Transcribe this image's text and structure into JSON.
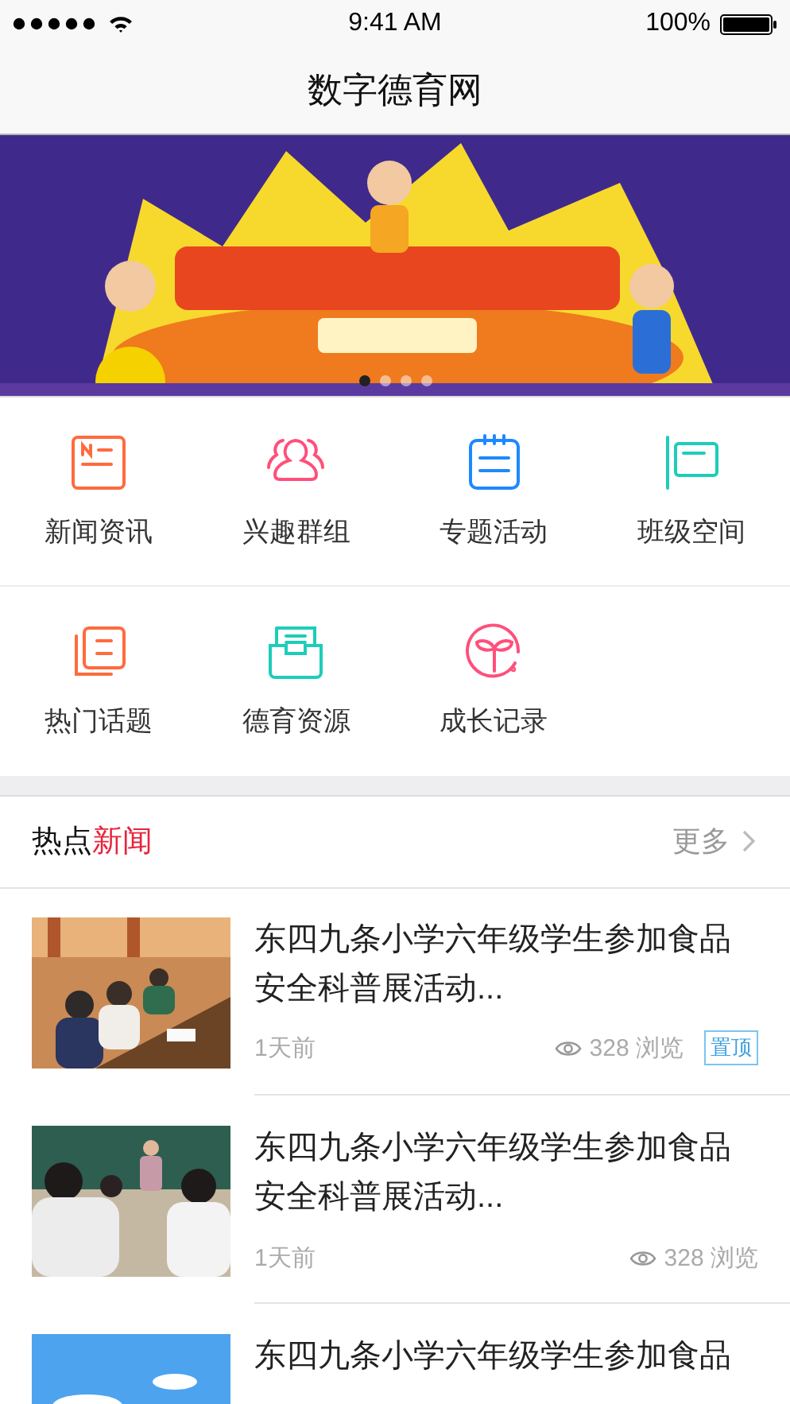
{
  "status_bar": {
    "time": "9:41 AM",
    "battery": "100%"
  },
  "nav": {
    "title": "数字德育网"
  },
  "banner": {
    "kind": "picture",
    "dots": [
      {
        "selected": true
      },
      {
        "selected": false
      },
      {
        "selected": false
      },
      {
        "selected": false
      }
    ]
  },
  "menu": [
    {
      "label": "新闻资讯",
      "color": "#ff6b3d"
    },
    {
      "label": "兴趣群组",
      "color": "#ff4f7b"
    },
    {
      "label": "专题活动",
      "color": "#1e88ff"
    },
    {
      "label": "班级空间",
      "color": "#1dcdb9"
    },
    {
      "label": "热门话题",
      "color": "#ff6b3d"
    },
    {
      "label": "德育资源",
      "color": "#1dcdb9"
    },
    {
      "label": "成长记录",
      "color": "#ff4f7b"
    }
  ],
  "section": {
    "title": "热点**新闻**",
    "more": "更多"
  },
  "news": [
    {
      "title": "东四九条小学六年级学生参加食品安全科普展活动...",
      "time": "1天前",
      "views": "328 浏览",
      "badge": "置顶"
    },
    {
      "title": "东四九条小学六年级学生参加食品安全科普展活动...",
      "time": "1天前",
      "views": "328 浏览"
    },
    {
      "title": "东四九条小学六年级学生参加食品"
    }
  ]
}
